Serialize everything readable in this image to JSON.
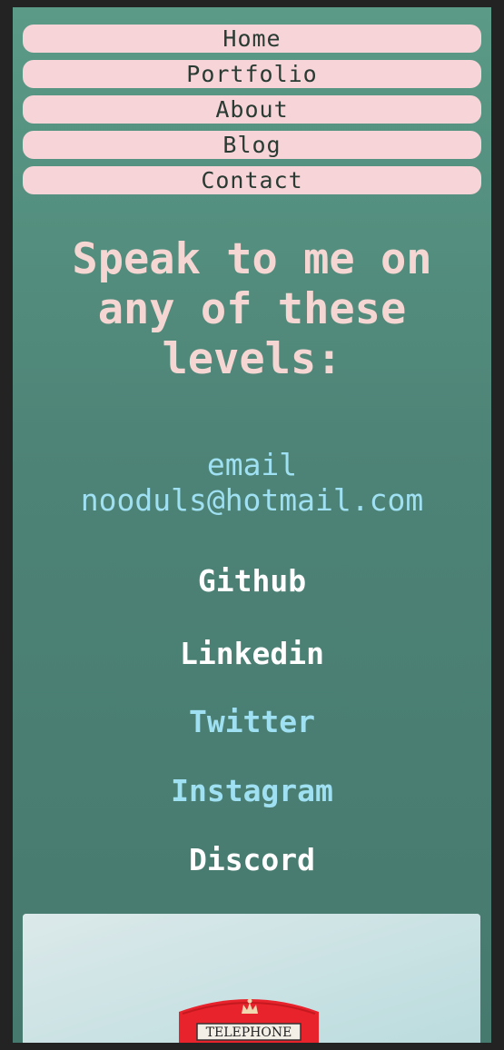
{
  "nav": {
    "items": [
      "Home",
      "Portfolio",
      "About",
      "Blog",
      "Contact"
    ]
  },
  "heading": {
    "lines": [
      "Speak to me on",
      "any of these",
      "levels:"
    ]
  },
  "email": {
    "label": "email",
    "address": "nooduls@hotmail.com"
  },
  "socials": [
    "Github",
    "Linkedin",
    "Twitter",
    "Instagram",
    "Discord"
  ],
  "photo": {
    "sign_text": "TELEPHONE"
  },
  "colors": {
    "nav_bg": "#f7d4d8",
    "heading": "#f6d6d2",
    "link_blue": "#9fe0f2",
    "link_white": "#ffffff",
    "booth_red": "#e8232c"
  }
}
